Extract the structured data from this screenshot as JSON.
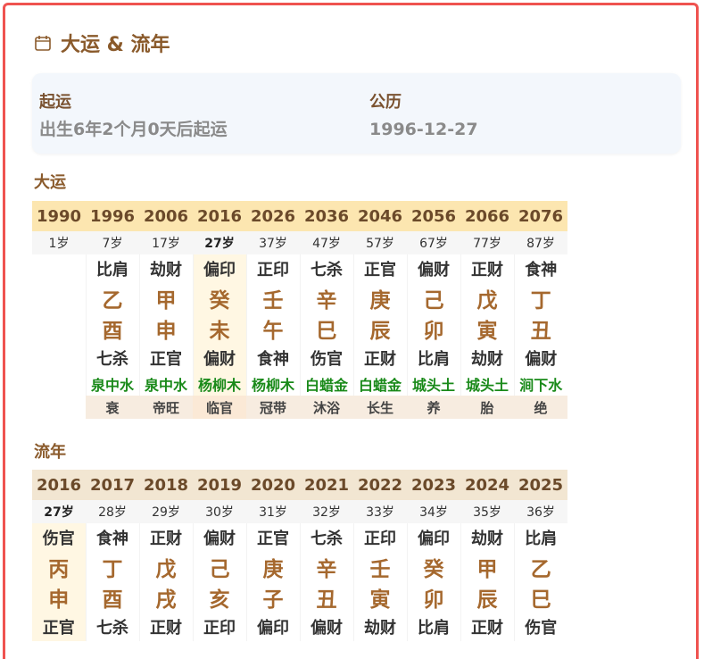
{
  "header": {
    "title": "大运 & 流年"
  },
  "info": {
    "qiyun_label": "起运",
    "qiyun_value": "出生6年2个月0天后起运",
    "gongli_label": "公历",
    "gongli_value": "1996-12-27"
  },
  "dayun": {
    "label": "大运",
    "years": [
      "1990",
      "1996",
      "2006",
      "2016",
      "2026",
      "2036",
      "2046",
      "2056",
      "2066",
      "2076"
    ],
    "ages": [
      "1岁",
      "7岁",
      "17岁",
      "27岁",
      "37岁",
      "47岁",
      "57岁",
      "67岁",
      "77岁",
      "87岁"
    ],
    "top_shen": [
      "",
      "比肩",
      "劫财",
      "偏印",
      "正印",
      "七杀",
      "正官",
      "偏财",
      "正财",
      "食神"
    ],
    "gan": [
      "",
      "乙",
      "甲",
      "癸",
      "壬",
      "辛",
      "庚",
      "己",
      "戊",
      "丁"
    ],
    "zhi": [
      "",
      "酉",
      "申",
      "未",
      "午",
      "巳",
      "辰",
      "卯",
      "寅",
      "丑"
    ],
    "bottom_shen": [
      "",
      "七杀",
      "正官",
      "偏财",
      "食神",
      "伤官",
      "正财",
      "比肩",
      "劫财",
      "偏财"
    ],
    "nayin": [
      "",
      "泉中水",
      "泉中水",
      "杨柳木",
      "杨柳木",
      "白蜡金",
      "白蜡金",
      "城头土",
      "城头土",
      "涧下水"
    ],
    "changsheng": [
      "",
      "衰",
      "帝旺",
      "临官",
      "冠带",
      "沐浴",
      "长生",
      "养",
      "胎",
      "绝"
    ]
  },
  "liunian": {
    "label": "流年",
    "years": [
      "2016",
      "2017",
      "2018",
      "2019",
      "2020",
      "2021",
      "2022",
      "2023",
      "2024",
      "2025"
    ],
    "ages": [
      "27岁",
      "28岁",
      "29岁",
      "30岁",
      "31岁",
      "32岁",
      "33岁",
      "34岁",
      "35岁",
      "36岁"
    ],
    "top_shen": [
      "伤官",
      "食神",
      "正财",
      "偏财",
      "正官",
      "七杀",
      "正印",
      "偏印",
      "劫财",
      "比肩"
    ],
    "gan": [
      "丙",
      "丁",
      "戊",
      "己",
      "庚",
      "辛",
      "壬",
      "癸",
      "甲",
      "乙"
    ],
    "zhi": [
      "申",
      "酉",
      "戌",
      "亥",
      "子",
      "丑",
      "寅",
      "卯",
      "辰",
      "巳"
    ],
    "bottom_shen": [
      "正官",
      "七杀",
      "正财",
      "正印",
      "偏印",
      "偏财",
      "劫财",
      "比肩",
      "正财",
      "伤官"
    ]
  }
}
